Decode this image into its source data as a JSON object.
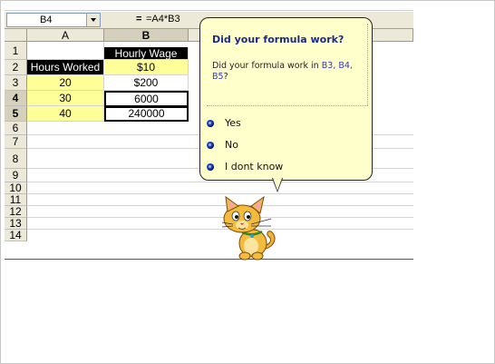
{
  "formula_bar": {
    "name_box": "B4",
    "equals": "=",
    "formula": "=A4*B3"
  },
  "columns": [
    "A",
    "B"
  ],
  "rows": [
    "1",
    "2",
    "3",
    "4",
    "5",
    "6",
    "7",
    "8",
    "9",
    "10",
    "11",
    "12",
    "13",
    "14"
  ],
  "cells": {
    "B1": "Hourly Wage",
    "A2": "Hours Worked",
    "B2": "$10",
    "A3": "20",
    "B3": "$200",
    "A4": "30",
    "B4": "6000",
    "A5": "40",
    "B5": "240000"
  },
  "balloon": {
    "title": "Did your formula work?",
    "text_prefix": "Did your formula work in ",
    "text_refs": "B3, B4, B5",
    "text_suffix": "?",
    "options": [
      "Yes",
      "No",
      "I dont know"
    ]
  },
  "colors": {
    "header_fill": "#000000",
    "input_fill": "#ffff99",
    "balloon_fill": "#ffffcc",
    "title_color": "#1a2a8a"
  },
  "icons": {
    "assistant": "office-cat-assistant-icon",
    "bullet": "blue-bullet-icon"
  }
}
